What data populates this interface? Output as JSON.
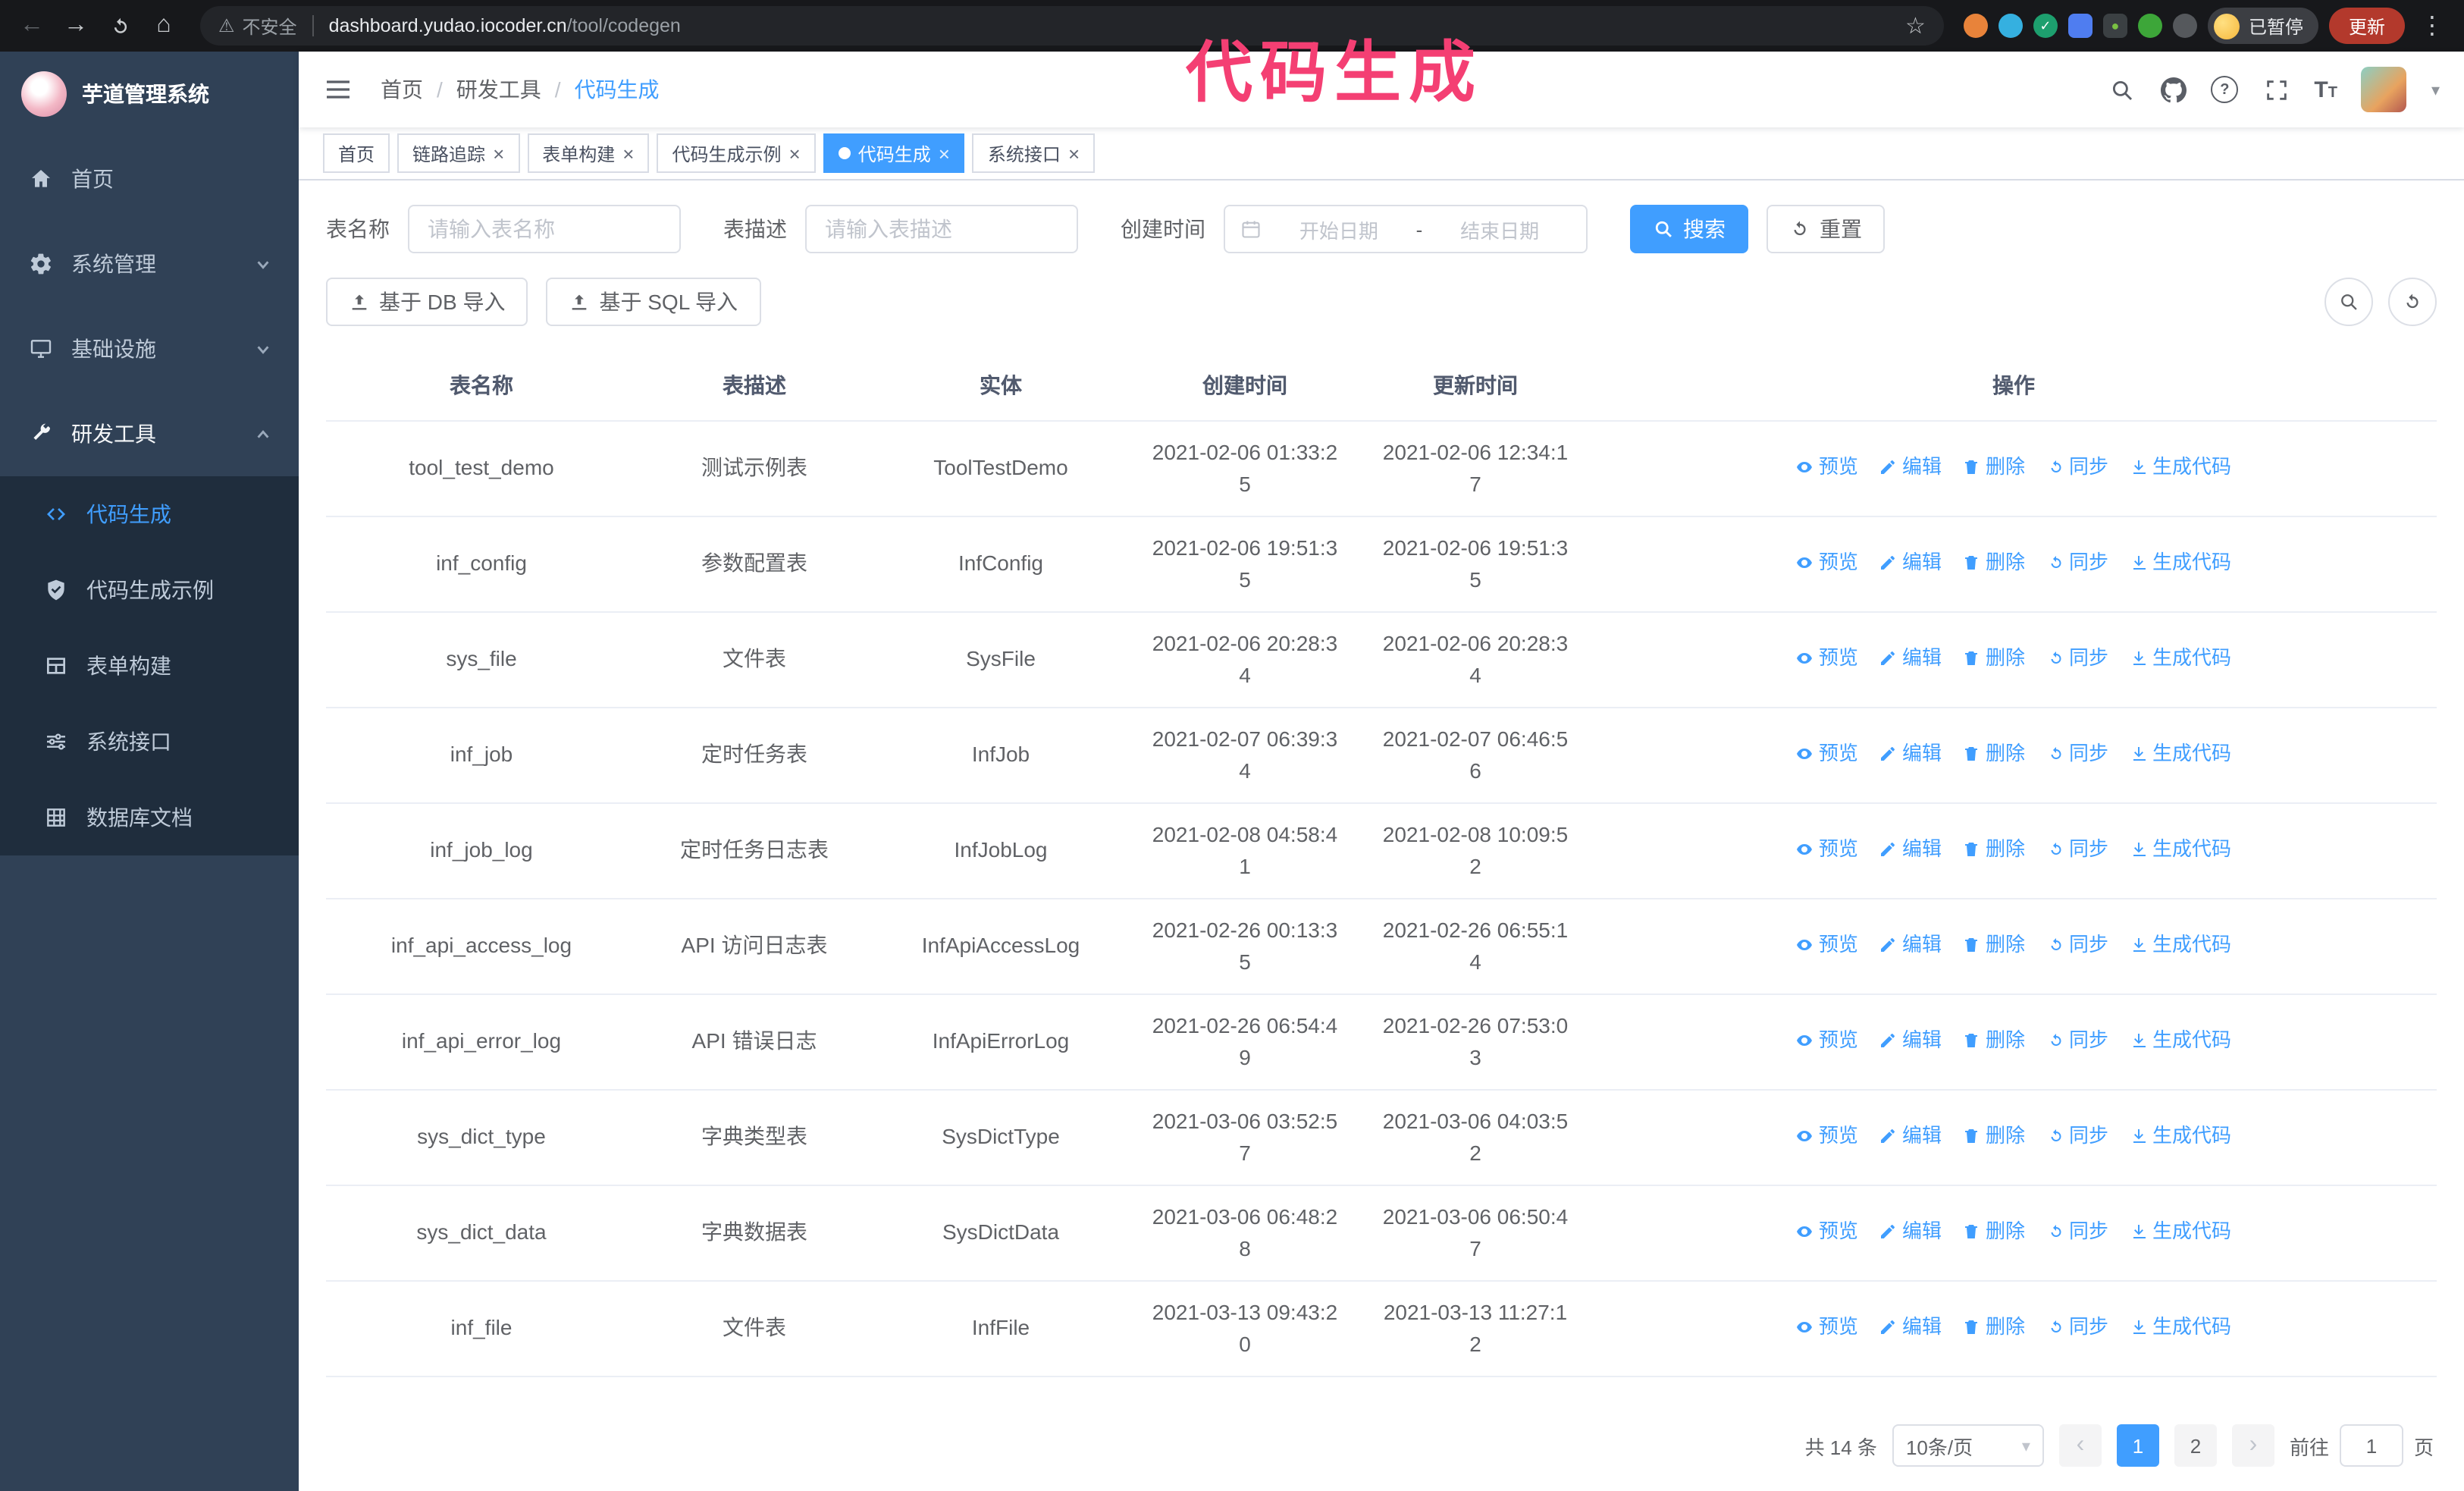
{
  "browser": {
    "security_label": "不安全",
    "url_host": "dashboard.yudao.iocoder.cn",
    "url_path": "/tool/codegen",
    "paused_badge": "已暂停",
    "update_button": "更新"
  },
  "annotation": {
    "text": "代码生成"
  },
  "sidebar": {
    "logo_title": "芋道管理系统",
    "items": [
      {
        "label": "首页"
      },
      {
        "label": "系统管理"
      },
      {
        "label": "基础设施"
      },
      {
        "label": "研发工具"
      }
    ],
    "sub_items": [
      {
        "label": "代码生成"
      },
      {
        "label": "代码生成示例"
      },
      {
        "label": "表单构建"
      },
      {
        "label": "系统接口"
      },
      {
        "label": "数据库文档"
      }
    ]
  },
  "header": {
    "breadcrumb": [
      "首页",
      "研发工具",
      "代码生成"
    ],
    "breadcrumb_separator": "/"
  },
  "tabs": [
    {
      "label": "首页",
      "closable": false,
      "active": false
    },
    {
      "label": "链路追踪",
      "closable": true,
      "active": false
    },
    {
      "label": "表单构建",
      "closable": true,
      "active": false
    },
    {
      "label": "代码生成示例",
      "closable": true,
      "active": false
    },
    {
      "label": "代码生成",
      "closable": true,
      "active": true
    },
    {
      "label": "系统接口",
      "closable": true,
      "active": false
    }
  ],
  "filters": {
    "table_name_label": "表名称",
    "table_name_placeholder": "请输入表名称",
    "table_desc_label": "表描述",
    "table_desc_placeholder": "请输入表描述",
    "create_time_label": "创建时间",
    "start_date_placeholder": "开始日期",
    "range_separator": "-",
    "end_date_placeholder": "结束日期",
    "search_button": "搜索",
    "reset_button": "重置"
  },
  "toolbar": {
    "import_db_button": "基于 DB 导入",
    "import_sql_button": "基于 SQL 导入"
  },
  "table": {
    "columns": [
      "表名称",
      "表描述",
      "实体",
      "创建时间",
      "更新时间",
      "操作"
    ],
    "actions": [
      "预览",
      "编辑",
      "删除",
      "同步",
      "生成代码"
    ],
    "rows": [
      {
        "name": "tool_test_demo",
        "desc": "测试示例表",
        "entity": "ToolTestDemo",
        "created": "2021-02-06 01:33:25",
        "updated": "2021-02-06 12:34:17"
      },
      {
        "name": "inf_config",
        "desc": "参数配置表",
        "entity": "InfConfig",
        "created": "2021-02-06 19:51:35",
        "updated": "2021-02-06 19:51:35"
      },
      {
        "name": "sys_file",
        "desc": "文件表",
        "entity": "SysFile",
        "created": "2021-02-06 20:28:34",
        "updated": "2021-02-06 20:28:34"
      },
      {
        "name": "inf_job",
        "desc": "定时任务表",
        "entity": "InfJob",
        "created": "2021-02-07 06:39:34",
        "updated": "2021-02-07 06:46:56"
      },
      {
        "name": "inf_job_log",
        "desc": "定时任务日志表",
        "entity": "InfJobLog",
        "created": "2021-02-08 04:58:41",
        "updated": "2021-02-08 10:09:52"
      },
      {
        "name": "inf_api_access_log",
        "desc": "API 访问日志表",
        "entity": "InfApiAccessLog",
        "created": "2021-02-26 00:13:35",
        "updated": "2021-02-26 06:55:14"
      },
      {
        "name": "inf_api_error_log",
        "desc": "API 错误日志",
        "entity": "InfApiErrorLog",
        "created": "2021-02-26 06:54:49",
        "updated": "2021-02-26 07:53:03"
      },
      {
        "name": "sys_dict_type",
        "desc": "字典类型表",
        "entity": "SysDictType",
        "created": "2021-03-06 03:52:57",
        "updated": "2021-03-06 04:03:52"
      },
      {
        "name": "sys_dict_data",
        "desc": "字典数据表",
        "entity": "SysDictData",
        "created": "2021-03-06 06:48:28",
        "updated": "2021-03-06 06:50:47"
      },
      {
        "name": "inf_file",
        "desc": "文件表",
        "entity": "InfFile",
        "created": "2021-03-13 09:43:20",
        "updated": "2021-03-13 11:27:12"
      }
    ]
  },
  "pagination": {
    "total": "共 14 条",
    "page_size": "10条/页",
    "pages": [
      "1",
      "2"
    ],
    "active_page": "1",
    "goto_prefix": "前往",
    "goto_value": "1",
    "goto_suffix": "页"
  },
  "colors": {
    "accent": "#409eff",
    "annotation": "#f43f73",
    "sidebar_bg": "#304156",
    "submenu_bg": "#1f2d3d",
    "update_button": "#b3392c"
  }
}
